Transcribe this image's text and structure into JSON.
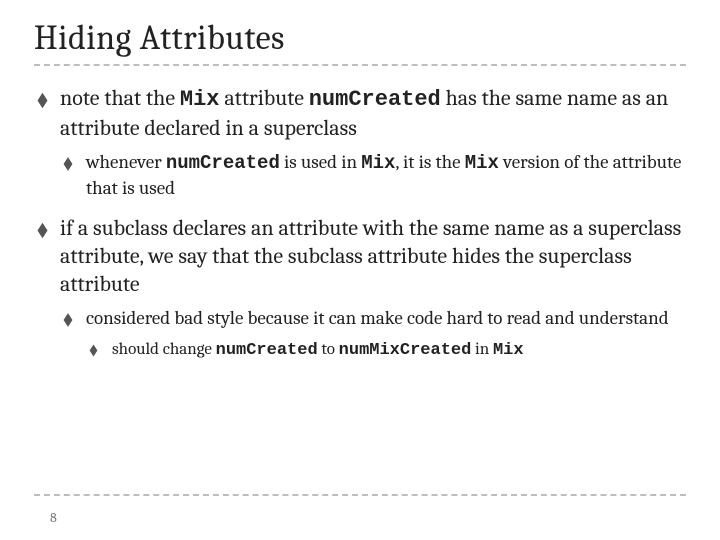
{
  "title": "Hiding Attributes",
  "page_number": "8",
  "code": {
    "mix": "Mix",
    "numCreated": "numCreated",
    "numMixCreated": "numMixCreated"
  },
  "b1": {
    "p1a": "note that the ",
    "p1b": " attribute ",
    "p1c": " has the same name as an attribute declared in a superclass",
    "s1a": "whenever ",
    "s1b": " is used in ",
    "s1c": ", it is the ",
    "s1d": " version of the attribute that is used"
  },
  "b2": {
    "p1": "if a subclass declares an attribute with the same name as a superclass attribute, we say that the subclass attribute hides the superclass attribute",
    "s1": "considered bad style because it can make code hard to read and understand",
    "ss1a": "should change ",
    "ss1b": " to ",
    "ss1c": " in "
  }
}
